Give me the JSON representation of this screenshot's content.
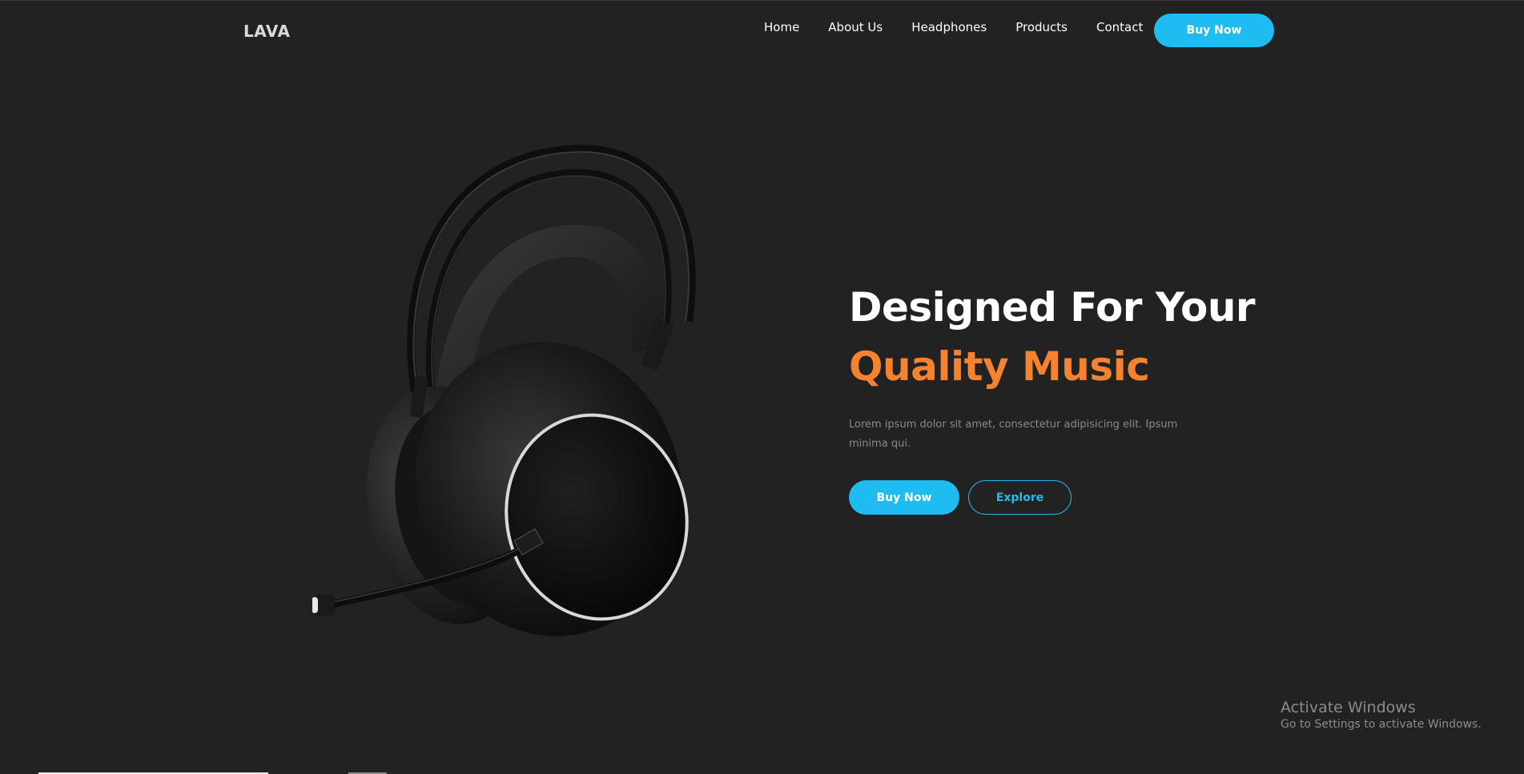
{
  "header": {
    "logo": "LAVA",
    "nav": [
      "Home",
      "About Us",
      "Headphones",
      "Products",
      "Contact"
    ],
    "cta": "Buy Now"
  },
  "hero": {
    "headline_line1": "Designed For Your",
    "headline_line2": "Quality Music",
    "description": "Lorem ipsum dolor sit amet, consectetur adipisicing elit. Ipsum minima qui.",
    "primary_button": "Buy Now",
    "secondary_button": "Explore",
    "image_icon": "headphones-product-image"
  },
  "os_watermark": {
    "title": "Activate Windows",
    "subtitle": "Go to Settings to activate Windows."
  },
  "colors": {
    "background": "#222222",
    "accent_blue": "#1fbcf2",
    "accent_orange": "#f5822f"
  }
}
